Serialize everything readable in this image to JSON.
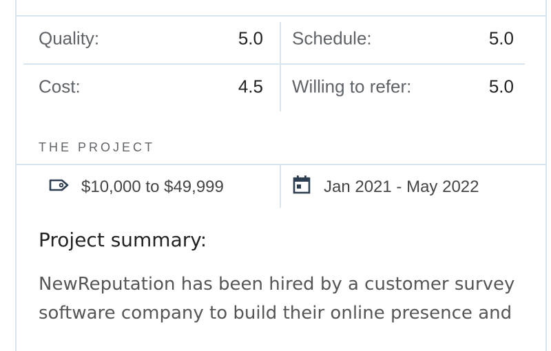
{
  "ratings": [
    {
      "label": "Quality:",
      "value": "5.0"
    },
    {
      "label": "Schedule:",
      "value": "5.0"
    },
    {
      "label": "Cost:",
      "value": "4.5"
    },
    {
      "label": "Willing to refer:",
      "value": "5.0"
    }
  ],
  "project": {
    "section_title": "THE PROJECT",
    "budget": "$10,000 to $49,999",
    "budget_icon": "tag-icon",
    "dates": "Jan 2021 - May 2022",
    "dates_icon": "calendar-icon"
  },
  "summary": {
    "title": "Project summary:",
    "text_line_1": "NewReputation has been hired by a customer survey",
    "text_line_2": "software company to build their online presence and"
  },
  "colors": {
    "divider": "#d7e6ee",
    "icon": "#2c3e50"
  }
}
